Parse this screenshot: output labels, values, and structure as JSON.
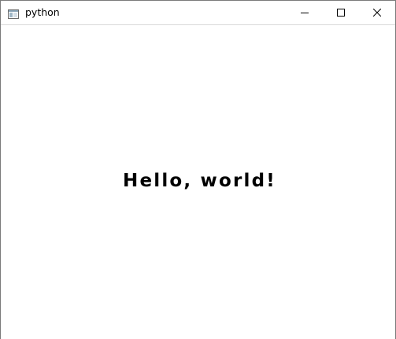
{
  "window": {
    "title": "python",
    "icon": "app-window-icon"
  },
  "titlebar_controls": {
    "minimize": "minimize-icon",
    "maximize": "maximize-icon",
    "close": "close-icon"
  },
  "client": {
    "message": "Hello, world!"
  },
  "colors": {
    "background": "#ffffff",
    "text": "#000000",
    "border": "#7a7a7a"
  }
}
